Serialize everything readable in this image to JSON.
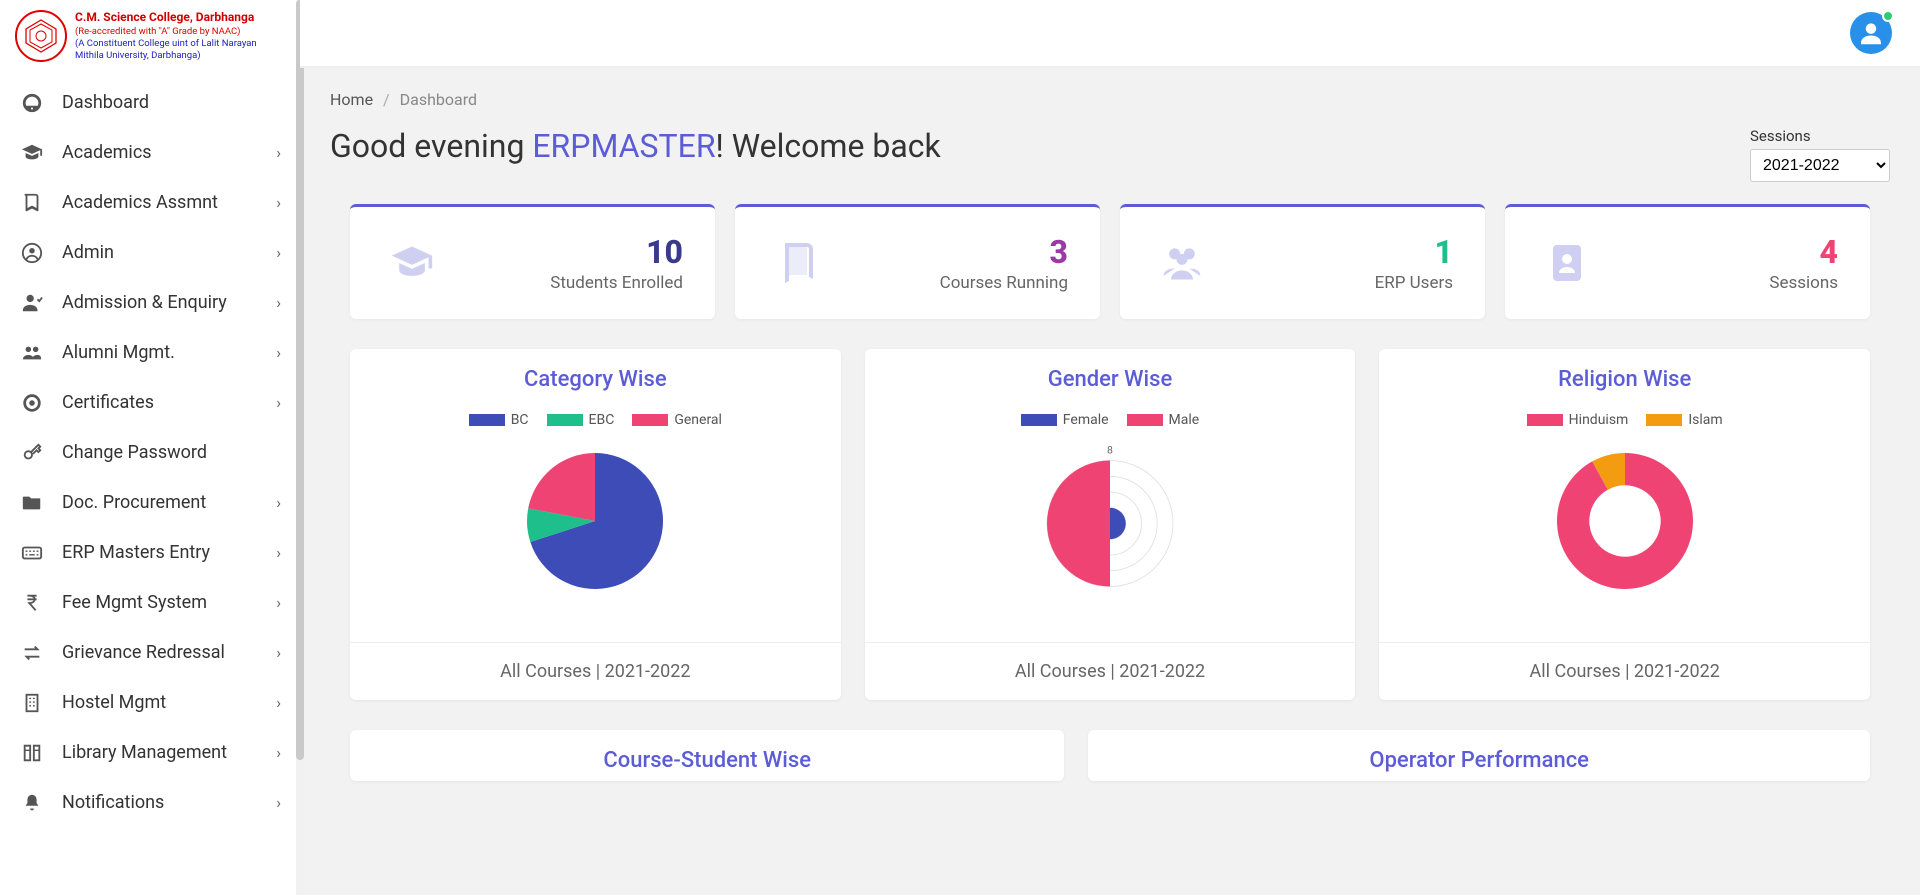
{
  "college": {
    "name": "C.M. Science College, Darbhanga",
    "line2": "(Re-accredited with \"A\" Grade by NAAC)",
    "line3": "(A Constituent College uint of Lalit Narayan",
    "line4": "Mithila University, Darbhanga)"
  },
  "sidebar": {
    "items": [
      {
        "label": "Dashboard",
        "icon": "dashboard",
        "expandable": false
      },
      {
        "label": "Academics",
        "icon": "graduation",
        "expandable": true
      },
      {
        "label": "Academics Assmnt",
        "icon": "book",
        "expandable": true
      },
      {
        "label": "Admin",
        "icon": "user-circle",
        "expandable": true
      },
      {
        "label": "Admission & Enquiry",
        "icon": "admission",
        "expandable": true
      },
      {
        "label": "Alumni Mgmt.",
        "icon": "group",
        "expandable": true
      },
      {
        "label": "Certificates",
        "icon": "badge",
        "expandable": true
      },
      {
        "label": "Change Password",
        "icon": "key",
        "expandable": false
      },
      {
        "label": "Doc. Procurement",
        "icon": "folder",
        "expandable": true
      },
      {
        "label": "ERP Masters Entry",
        "icon": "keyboard",
        "expandable": true
      },
      {
        "label": "Fee Mgmt System",
        "icon": "rupee",
        "expandable": true
      },
      {
        "label": "Grievance Redressal",
        "icon": "exchange",
        "expandable": true
      },
      {
        "label": "Hostel Mgmt",
        "icon": "building",
        "expandable": true
      },
      {
        "label": "Library Management",
        "icon": "library",
        "expandable": true
      },
      {
        "label": "Notifications",
        "icon": "bell",
        "expandable": true
      }
    ]
  },
  "breadcrumb": {
    "home": "Home",
    "current": "Dashboard"
  },
  "greeting": {
    "prefix": "Good evening ",
    "user": "ERPMASTER",
    "suffix": "! Welcome back"
  },
  "sessions": {
    "label": "Sessions",
    "selected": "2021-2022",
    "options": [
      "2021-2022"
    ]
  },
  "stats": [
    {
      "value": "10",
      "label": "Students Enrolled",
      "color": "#3a3a8a",
      "icon": "graduation"
    },
    {
      "value": "3",
      "label": "Courses Running",
      "color": "#9b3aa5",
      "icon": "book"
    },
    {
      "value": "1",
      "label": "ERP Users",
      "color": "#1fbf8c",
      "icon": "group"
    },
    {
      "value": "4",
      "label": "Sessions",
      "color": "#ef4373",
      "icon": "address-book"
    }
  ],
  "chart_data": [
    {
      "id": "category",
      "title": "Category Wise",
      "type": "pie",
      "footer": "All Courses | 2021-2022",
      "series": [
        {
          "name": "BC",
          "value": 70,
          "color": "#3e4cb8"
        },
        {
          "name": "EBC",
          "value": 8,
          "color": "#1fbf8c"
        },
        {
          "name": "General",
          "value": 22,
          "color": "#ef4373"
        }
      ]
    },
    {
      "id": "gender",
      "title": "Gender Wise",
      "type": "polar",
      "footer": "All Courses | 2021-2022",
      "max_label": "8",
      "series": [
        {
          "name": "Female",
          "value": 2,
          "color": "#3e4cb8"
        },
        {
          "name": "Male",
          "value": 8,
          "color": "#ef4373"
        }
      ]
    },
    {
      "id": "religion",
      "title": "Religion Wise",
      "type": "donut",
      "footer": "All Courses | 2021-2022",
      "series": [
        {
          "name": "Hinduism",
          "value": 92,
          "color": "#ef4373"
        },
        {
          "name": "Islam",
          "value": 8,
          "color": "#f39c12"
        }
      ]
    }
  ],
  "lower_cards": [
    {
      "title": "Course-Student Wise"
    },
    {
      "title": "Operator Performance"
    }
  ]
}
